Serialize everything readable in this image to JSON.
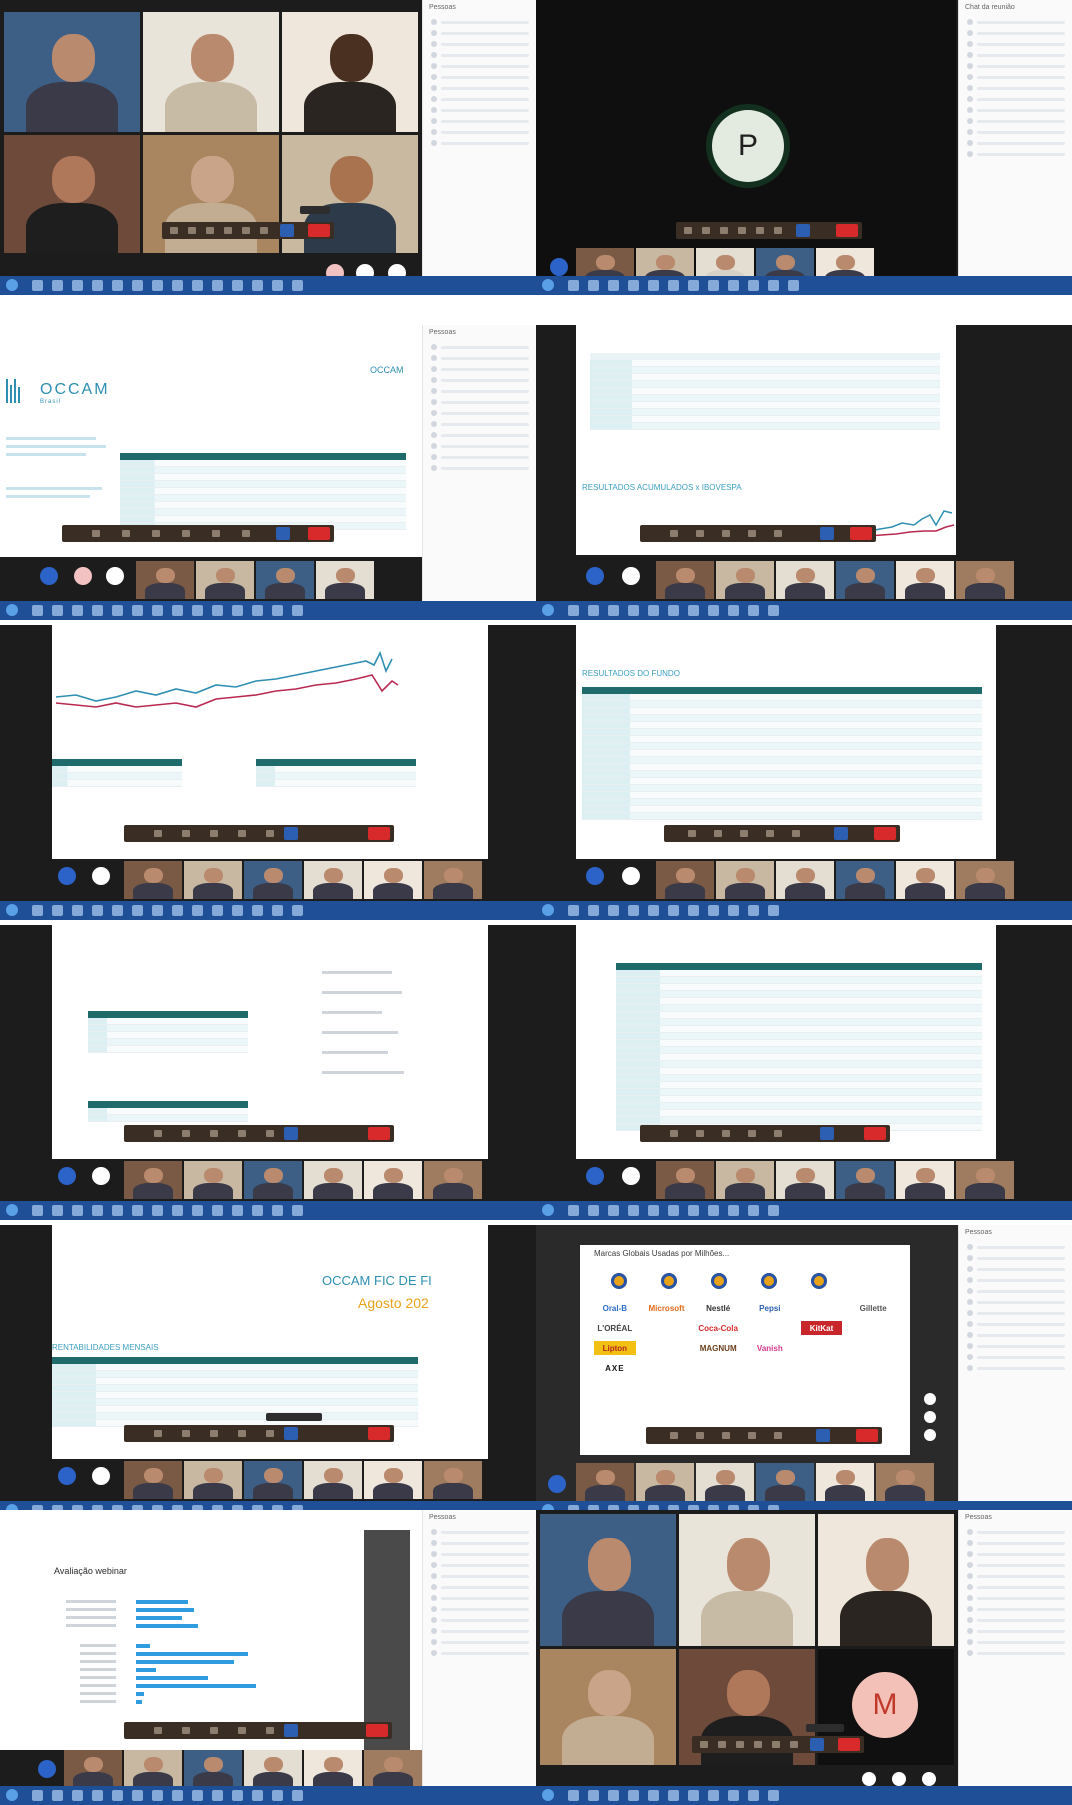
{
  "panels": [
    {
      "id": "p1",
      "kind": "grid",
      "side_title": "Pessoas"
    },
    {
      "id": "p2",
      "kind": "avatar",
      "avatar_letter": "P",
      "side_title": "Chat da reunião"
    },
    {
      "id": "p3",
      "kind": "occam",
      "brand": "OCCAM",
      "brand_sub": "Brasil",
      "brand_right": "OCCAM",
      "side_title": "Pessoas"
    },
    {
      "id": "p4",
      "kind": "tables_line",
      "section_title": "RESULTADOS ACUMULADOS x IBOVESPA"
    },
    {
      "id": "p5",
      "kind": "bigline"
    },
    {
      "id": "p6",
      "kind": "table",
      "section_title": "RESULTADOS DO FUNDO"
    },
    {
      "id": "p7",
      "kind": "portfolio"
    },
    {
      "id": "p8",
      "kind": "table_big"
    },
    {
      "id": "p9",
      "kind": "fund",
      "fund_title": "OCCAM FIC DE FI",
      "fund_date": "Agosto 202",
      "section_title": "RENTABILIDADES MENSAIS"
    },
    {
      "id": "p10",
      "kind": "logos",
      "slide_title": "Marcas Globais Usadas por Milhões...",
      "side_title": "Pessoas",
      "logos": [
        "Oral-B",
        "Microsoft",
        "Nestlé",
        "Pepsi",
        "",
        "Gillette",
        "L'ORÉAL",
        "",
        "Coca-Cola",
        "",
        "KitKat",
        "",
        "Lipton",
        "",
        "MAGNUM",
        "Vanish",
        "",
        "",
        "AXE",
        "",
        "",
        "",
        "",
        ""
      ]
    },
    {
      "id": "p11",
      "kind": "poll",
      "poll_title": "Avaliação webinar",
      "side_title": "Pessoas"
    },
    {
      "id": "p12",
      "kind": "grid2",
      "avatar_letter": "M",
      "side_title": "Pessoas"
    }
  ]
}
